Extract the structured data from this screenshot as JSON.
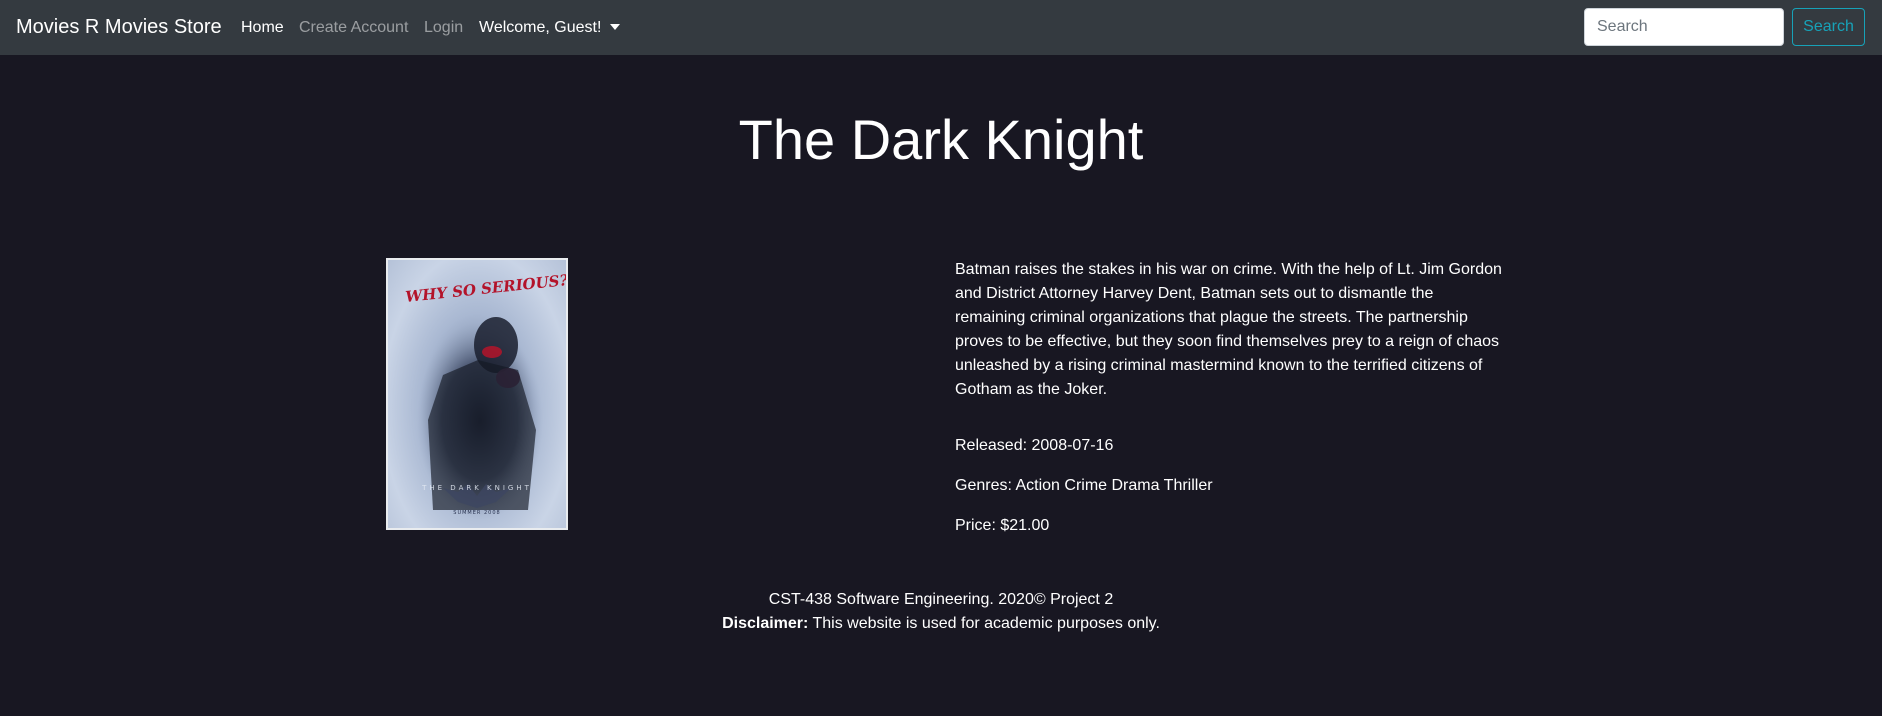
{
  "navbar": {
    "brand": "Movies R Movies Store",
    "links": {
      "home": "Home",
      "create_account": "Create Account",
      "login": "Login",
      "welcome": "Welcome, Guest!"
    },
    "search": {
      "placeholder": "Search",
      "value": "",
      "button_label": "Search"
    }
  },
  "movie": {
    "title": "The Dark Knight",
    "description": "Batman raises the stakes in his war on crime. With the help of Lt. Jim Gordon and District Attorney Harvey Dent, Batman sets out to dismantle the remaining criminal organizations that plague the streets. The partnership proves to be effective, but they soon find themselves prey to a reign of chaos unleashed by a rising criminal mastermind known to the terrified citizens of Gotham as the Joker.",
    "released": "Released: 2008-07-16",
    "genres": "Genres: Action Crime Drama Thriller",
    "price": "Price: $21.00",
    "poster": {
      "tagline": "WHY SO SERIOUS?",
      "title_text": "THE DARK KNIGHT",
      "date_text": "SUMMER 2008"
    }
  },
  "footer": {
    "line1": "CST-438 Software Engineering. 2020© Project 2",
    "disclaimer_label": "Disclaimer:",
    "disclaimer_text": " This website is used for academic purposes only."
  },
  "colors": {
    "page_background": "#181722",
    "navbar_background": "#343a40",
    "search_button_accent": "#17a2b8"
  }
}
